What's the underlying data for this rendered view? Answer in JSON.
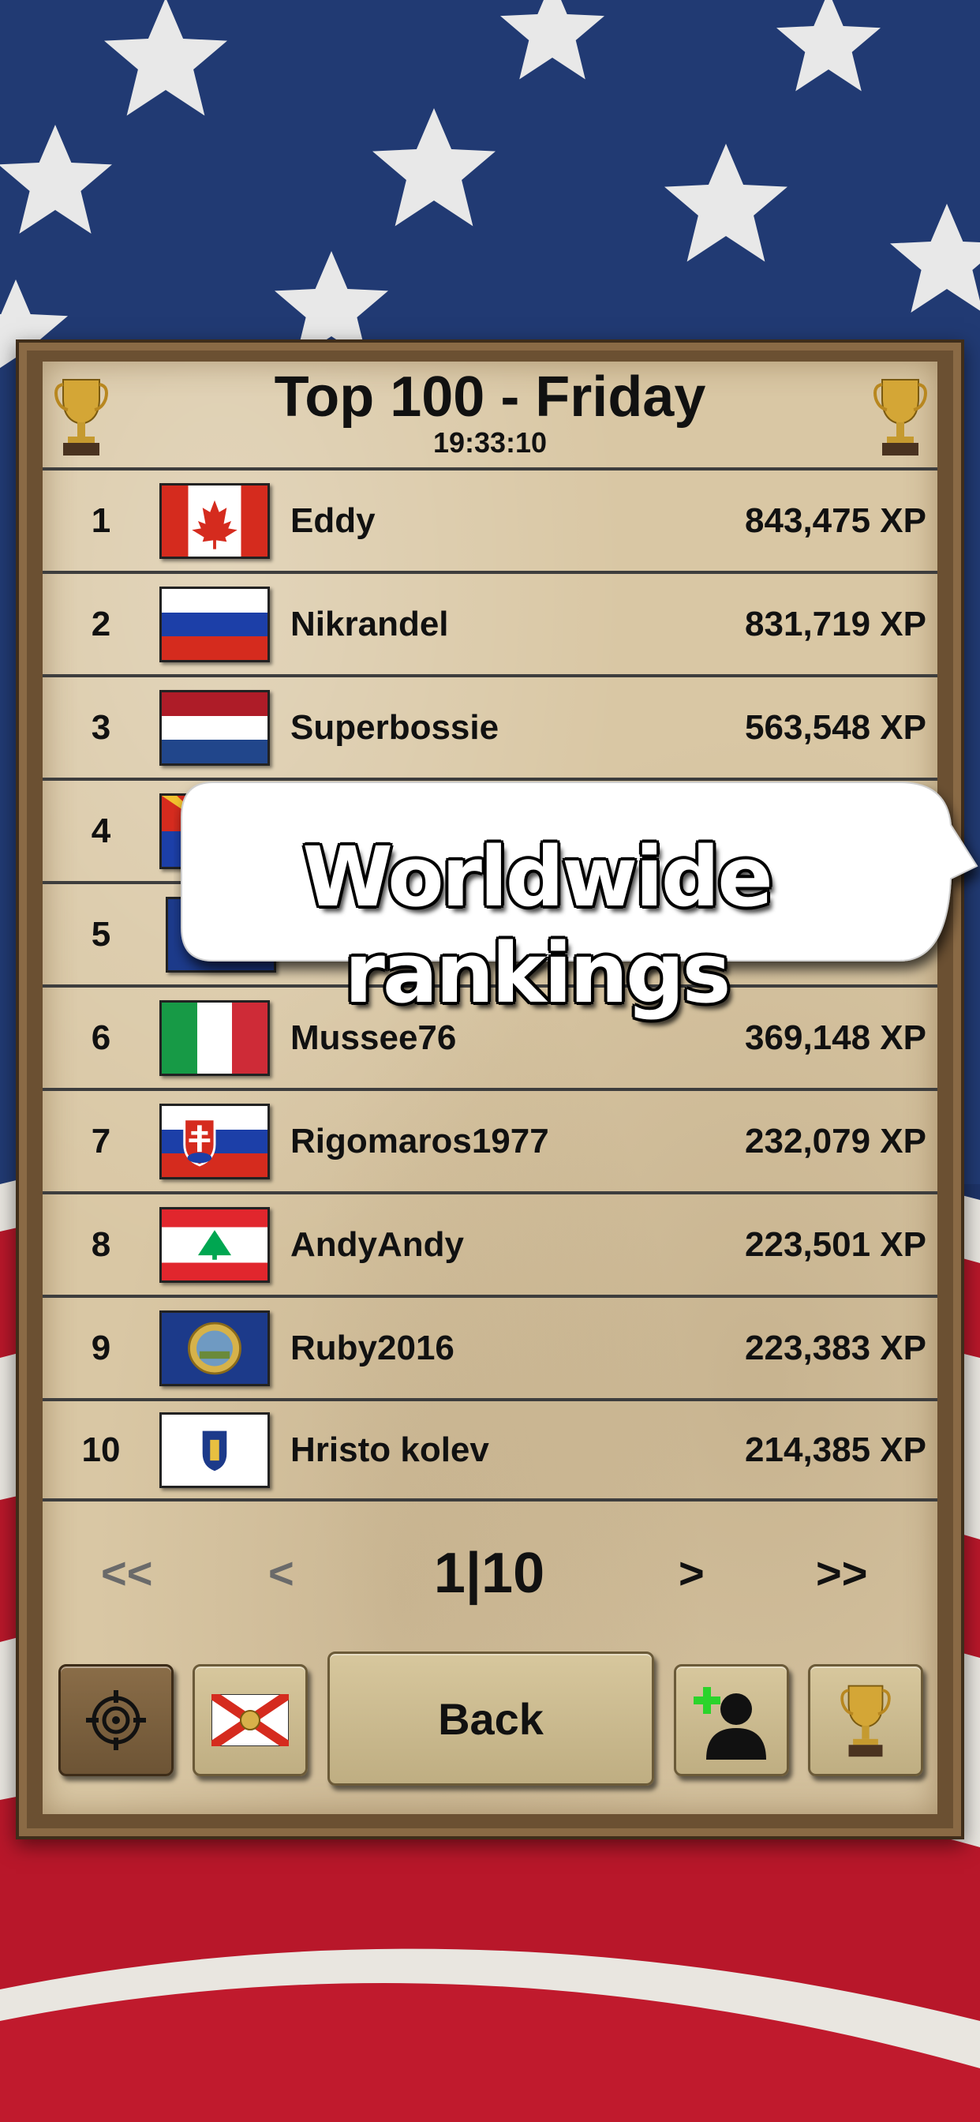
{
  "header": {
    "title": "Top 100 - Friday",
    "time": "19:33:10"
  },
  "rankings": [
    {
      "rank": "1",
      "name": "Eddy",
      "xp": "843,475 XP",
      "flag": "canada"
    },
    {
      "rank": "2",
      "name": "Nikrandel",
      "xp": "831,719 XP",
      "flag": "russia"
    },
    {
      "rank": "3",
      "name": "Superbossie",
      "xp": "563,548 XP",
      "flag": "netherlands"
    },
    {
      "rank": "4",
      "name": "",
      "xp": "",
      "flag": "arizona"
    },
    {
      "rank": "5",
      "name": "",
      "xp": "",
      "flag": "blue-state-seal"
    },
    {
      "rank": "6",
      "name": "Mussee76",
      "xp": "369,148 XP",
      "flag": "italy"
    },
    {
      "rank": "7",
      "name": "Rigomaros1977",
      "xp": "232,079 XP",
      "flag": "slovakia"
    },
    {
      "rank": "8",
      "name": "AndyAndy",
      "xp": "223,501 XP",
      "flag": "lebanon"
    },
    {
      "rank": "9",
      "name": "Ruby2016",
      "xp": "223,383 XP",
      "flag": "nebraska"
    },
    {
      "rank": "10",
      "name": "Hristo kolev",
      "xp": "214,385 XP",
      "flag": "massachusetts"
    }
  ],
  "overlay": {
    "caption": "Worldwide rankings"
  },
  "pagination": {
    "first": "<<",
    "prev": "<",
    "indicator": "1|10",
    "next": ">",
    "last": ">>"
  },
  "toolbar": {
    "back_label": "Back",
    "icons": [
      "target-icon",
      "florida-flag-icon",
      "add-friend-icon",
      "trophy-icon"
    ]
  },
  "colors": {
    "paper": "#d9c7a4",
    "frame": "#6b5032",
    "text": "#111111",
    "pager_dim": "#6a6a6a"
  }
}
